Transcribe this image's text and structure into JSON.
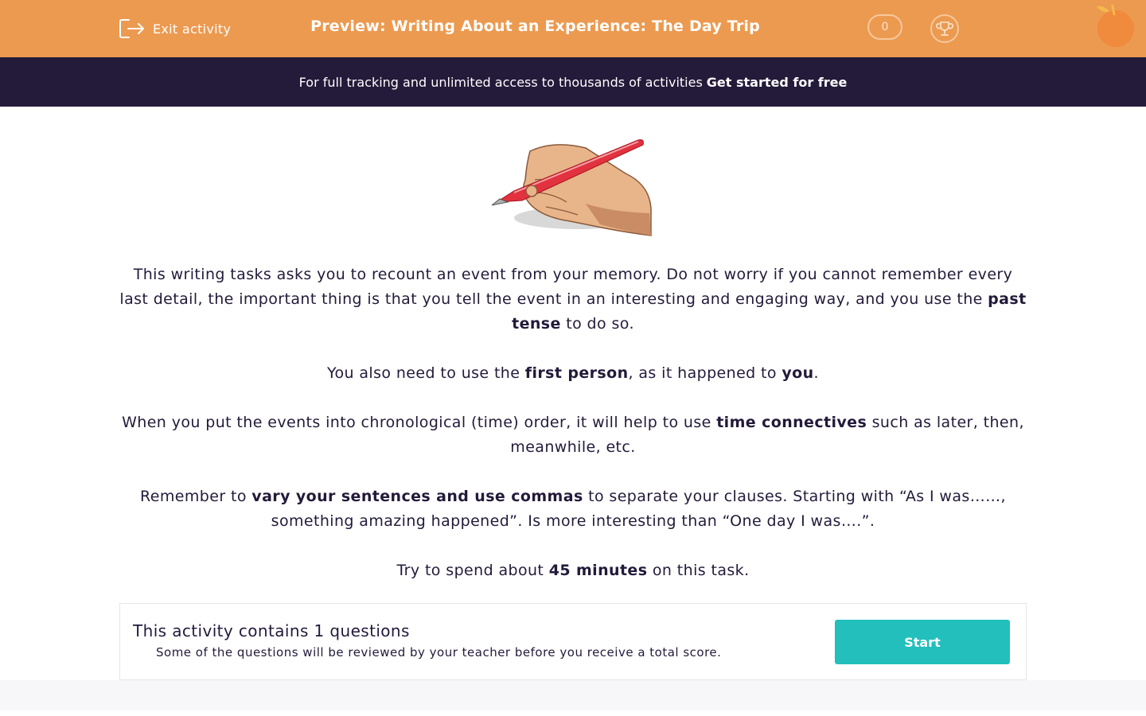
{
  "header": {
    "exit_label": "Exit activity",
    "title": "Preview: Writing About an Experience: The Day Trip",
    "score": "0",
    "accent_color": "#ec9a50",
    "icons": [
      "exit-icon",
      "trophy-icon",
      "orange-logo-icon"
    ]
  },
  "banner": {
    "text": "For full tracking and unlimited access to thousands of activities",
    "link": "Get started for free",
    "background": "#241a3a"
  },
  "instructions": {
    "p1": {
      "a": "This writing tasks asks you to recount an event from your memory. Do not worry if you cannot remember every last detail, the important thing is that you tell the event in an interesting and engaging way, and you use the ",
      "b": "past tense",
      "c": " to do so."
    },
    "p2": {
      "a": "You also need to use the ",
      "b": "first person",
      "c": ", as it happened to ",
      "d": "you",
      "e": "."
    },
    "p3": {
      "a": "When you put the events into chronological (time) order, it will help to use ",
      "b": "time connectives",
      "c": " such as later, then, meanwhile, etc."
    },
    "p4": {
      "a": "Remember to ",
      "b": "vary your sentences and use commas",
      "c": " to separate your clauses. Starting with “As I was……, something amazing happened”. Is more interesting than “One day I was….”."
    },
    "p5": {
      "a": "Try to spend about ",
      "b": "45 minutes",
      "c": " on this task."
    }
  },
  "card": {
    "title": "This activity contains 1 questions",
    "subtitle": "Some of the questions will be reviewed by your teacher before you receive a total score.",
    "start_label": "Start",
    "button_color": "#22bfbd"
  }
}
